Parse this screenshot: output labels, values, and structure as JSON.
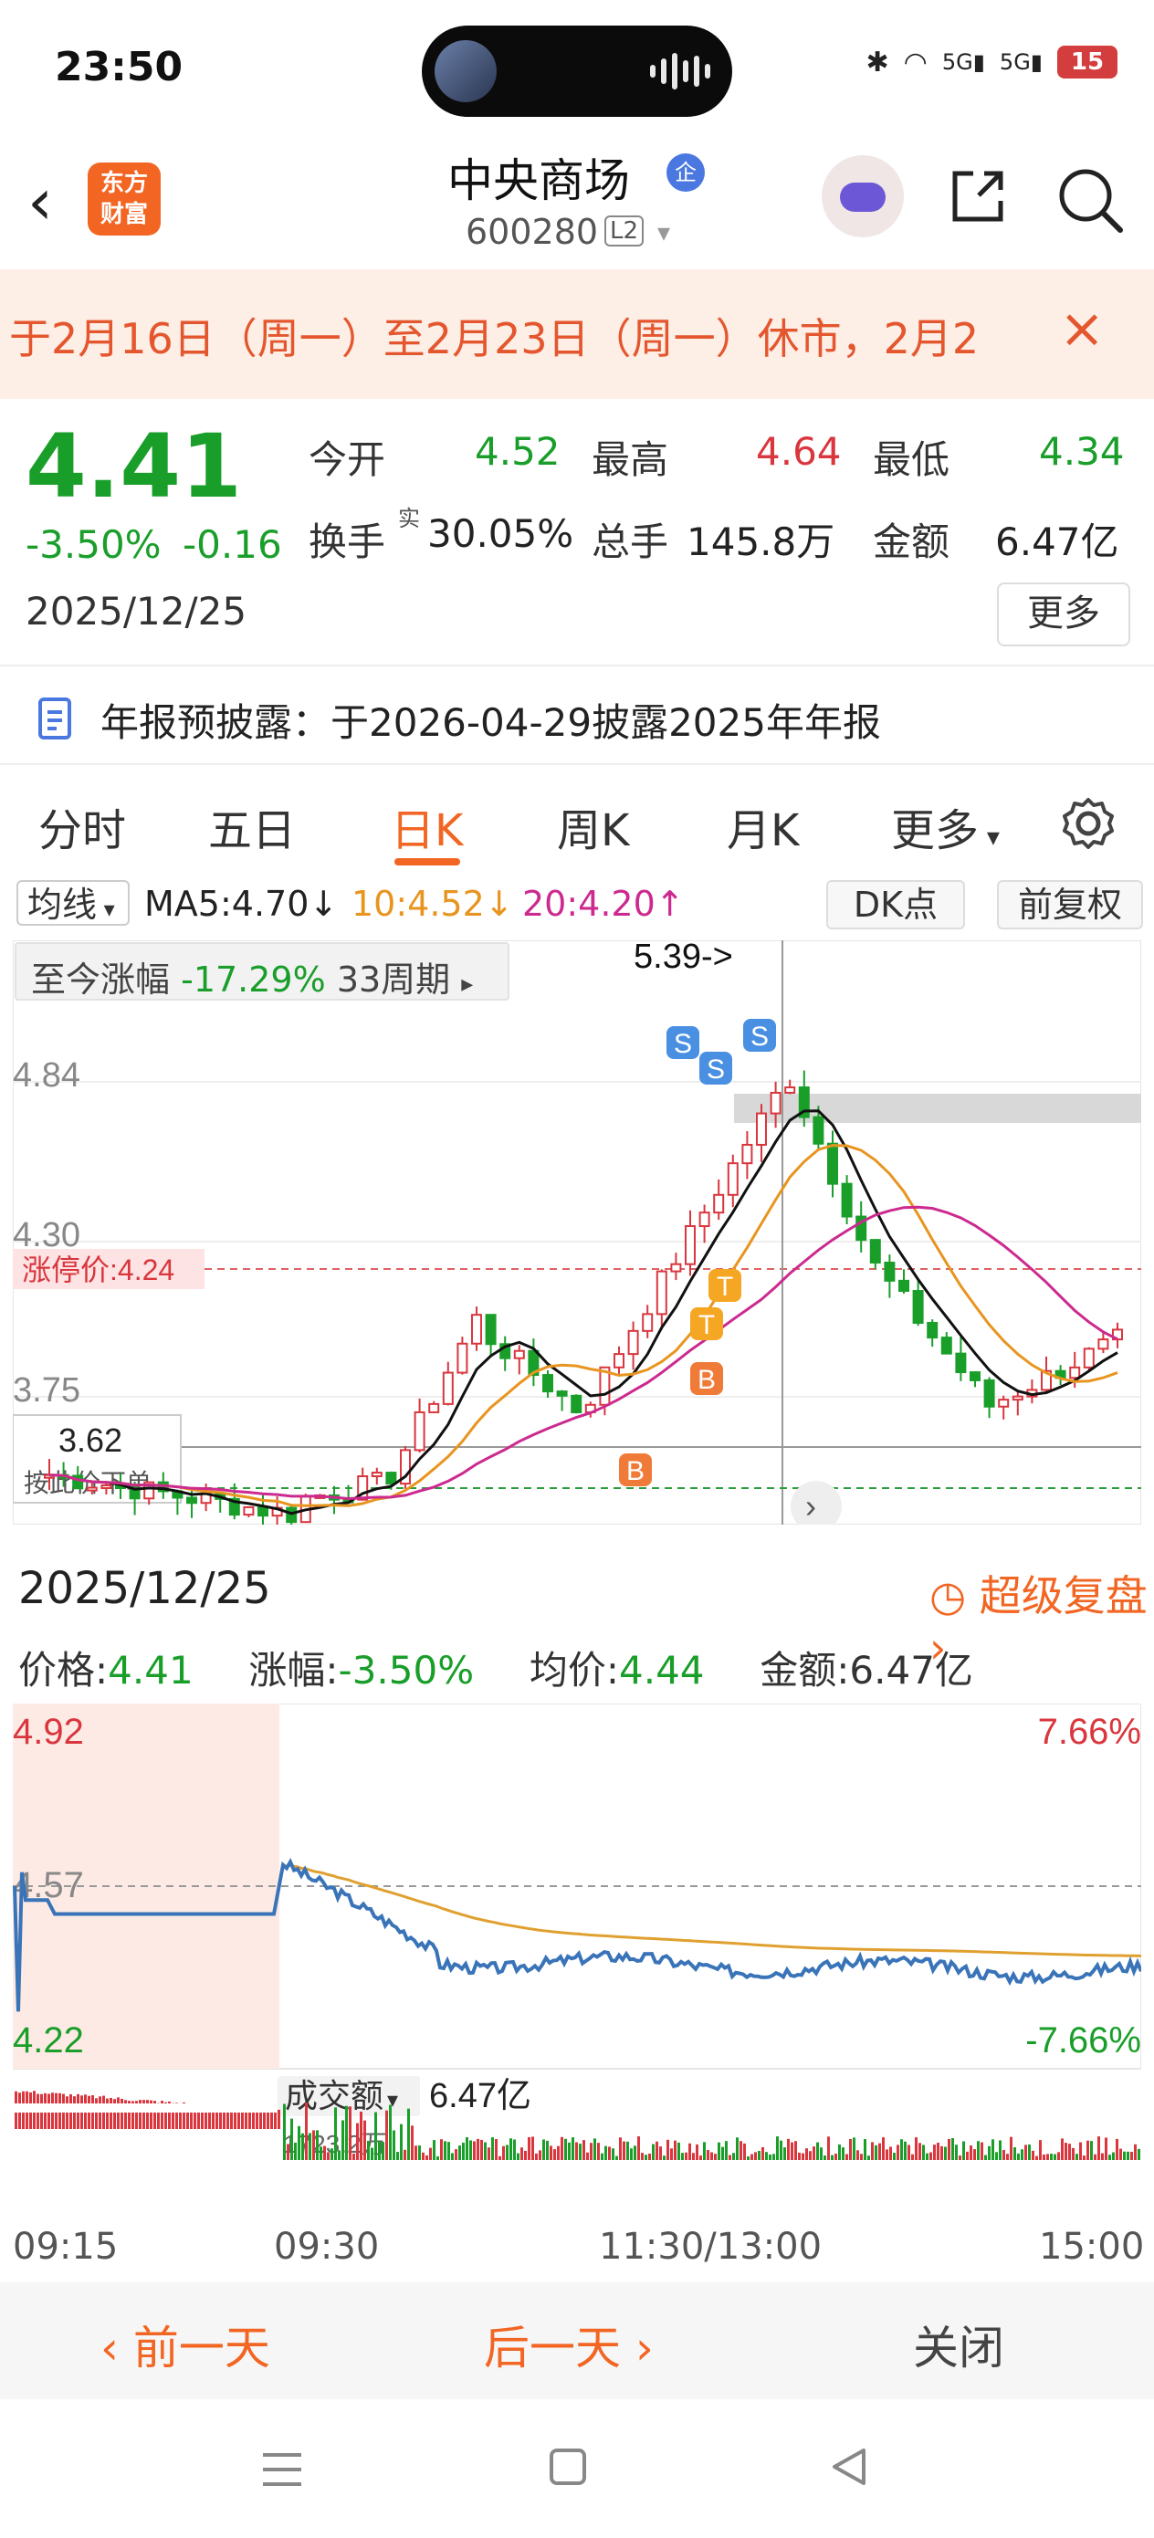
{
  "status_bar": {
    "time": "23:50",
    "battery": "15"
  },
  "header": {
    "logo_line1": "东方",
    "logo_line2": "财富",
    "stock_name": "中央商场",
    "badge": "企",
    "code": "600280",
    "level": "L2"
  },
  "notice": {
    "text": "于2月16日（周一）至2月23日（周一）休市，2月2",
    "close": "×"
  },
  "quote": {
    "price": "4.41",
    "change_pct": "-3.50%",
    "change": "-0.16",
    "date": "2025/12/25",
    "open_label": "今开",
    "open": "4.52",
    "high_label": "最高",
    "high": "4.64",
    "low_label": "最低",
    "low": "4.34",
    "turnover_label": "换手",
    "turnover_sup": "实",
    "turnover": "30.05%",
    "volume_label": "总手",
    "volume": "145.8万",
    "amount_label": "金额",
    "amount": "6.47亿",
    "more": "更多"
  },
  "report": {
    "text": "年报预披露：于2026-04-29披露2025年年报"
  },
  "tabs": [
    "分时",
    "五日",
    "日K",
    "周K",
    "月K",
    "更多"
  ],
  "ma_bar": {
    "toggle": "均线",
    "ma5": "MA5:4.70↓",
    "ma10": "10:4.52↓",
    "ma20": "20:4.20↑",
    "dk": "DK点",
    "adjust": "前复权"
  },
  "kline": {
    "range_label": "至今涨幅",
    "range_pct": "-17.29%",
    "range_period": "33周期",
    "peak_label": "5.39->",
    "y_ticks": [
      "4.84",
      "4.30",
      "3.75"
    ],
    "limit_label": "涨停价:4.24",
    "cursor_price": "3.62",
    "order_hint": "按此价下单",
    "signals": [
      "S",
      "S",
      "S",
      "B",
      "B",
      "T",
      "T"
    ]
  },
  "minute": {
    "date": "2025/12/25",
    "replay": "超级复盘",
    "price_label": "价格:",
    "price": "4.41",
    "chg_label": "涨幅:",
    "chg": "-3.50%",
    "avg_label": "均价:",
    "avg": "4.44",
    "amt_label": "金额:",
    "amt": "6.47亿",
    "y_top": "4.92",
    "y_mid": "4.57",
    "y_bot": "4.22",
    "pct_top": "7.66%",
    "pct_bot": "-7.66%",
    "vol_label": "成交额",
    "vol_value": "6.47亿",
    "vol_peak": "1723.2万",
    "times": [
      "09:15",
      "09:30",
      "11:30/13:00",
      "15:00"
    ]
  },
  "footer": {
    "prev": "前一天",
    "next": "后一天",
    "close": "关闭"
  },
  "colors": {
    "up": "#d9363e",
    "down": "#1a9e2a",
    "accent": "#f26522",
    "ma5": "#111111",
    "ma10": "#e89520",
    "ma20": "#cc2a8f",
    "price_line": "#3a74b8",
    "avg_line": "#e0a030"
  }
}
